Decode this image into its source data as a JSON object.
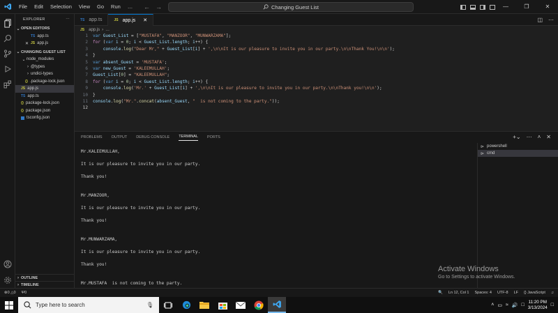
{
  "menu": [
    "File",
    "Edit",
    "Selection",
    "View",
    "Go",
    "Run",
    "…"
  ],
  "command_center": "Changing Guest List",
  "sidebar": {
    "header": "EXPLORER",
    "open_editors_label": "OPEN EDITORS",
    "open_editors": [
      "app.ts",
      "app.js"
    ],
    "project_label": "CHANGING GUEST LIST",
    "tree": [
      {
        "name": "node_modules",
        "kind": "folder",
        "open": true
      },
      {
        "name": "@types",
        "kind": "folder",
        "open": false
      },
      {
        "name": "undici-types",
        "kind": "folder",
        "open": false
      },
      {
        "name": ".package-lock.json",
        "kind": "json"
      },
      {
        "name": "app.js",
        "kind": "js"
      },
      {
        "name": "app.ts",
        "kind": "ts"
      },
      {
        "name": "package-lock.json",
        "kind": "json"
      },
      {
        "name": "package.json",
        "kind": "json"
      },
      {
        "name": "tsconfig.json",
        "kind": "tsconfig"
      }
    ],
    "outline_label": "OUTLINE",
    "timeline_label": "TIMELINE"
  },
  "tabs": [
    {
      "label": "app.ts",
      "active": false
    },
    {
      "label": "app.js",
      "active": true
    }
  ],
  "breadcrumb": [
    "app.js",
    "…"
  ],
  "code_lines": [
    "var Guest_List = [\"MUSTAFA\", \"MANZOOR\", \"MUNWARZAMA\"];",
    "for (var i = 0; i < Guest_List.length; i++) {",
    "    console.log(\"Dear Mr,\" + Guest_List[i] + ',\\n\\nIt is our pleasure to invite you in our party.\\n\\nThank You!\\n\\n');",
    "}",
    "var absent_Guest = 'MUSTAFA';",
    "var new_Guest = 'KALEEMULLAH';",
    "Guest_List[0] = \"KALEEMULLAH\";",
    "for (var i = 0; i < Guest_List.length; i++) {",
    "    console.log('Mr.' + Guest_List[i] + ',\\n\\nIt is our pleasure to invite you in our party.\\n\\nThank you!\\n\\n');",
    "}",
    "console.log(\"Mr.\".concat(absent_Guest, \"  is not coming to the party.\"));",
    ""
  ],
  "panel": {
    "tabs": [
      "PROBLEMS",
      "OUTPUT",
      "DEBUG CONSOLE",
      "TERMINAL",
      "PORTS"
    ],
    "active_tab": "TERMINAL",
    "terminal_lines": [
      "Mr.KALEEMULLAH,",
      "",
      "It is our pleasure to invite you in our party.",
      "",
      "Thank you!",
      "",
      "",
      "Mr.MANZOOR,",
      "",
      "It is our pleasure to invite you in our party.",
      "",
      "Thank you!",
      "",
      "",
      "Mr.MUNWARZAMA,",
      "",
      "It is our pleasure to invite you in our party.",
      "",
      "Thank you!",
      "",
      "",
      "Mr.MUSTAFA  is not coming to the party."
    ],
    "terminals": [
      "powershell",
      "cmd"
    ]
  },
  "watermark": {
    "title": "Activate Windows",
    "subtitle": "Go to Settings to activate Windows."
  },
  "status": {
    "errors": "0",
    "warnings": "0",
    "ports": "0",
    "position": "Ln 12, Col 1",
    "spaces": "Spaces: 4",
    "encoding": "UTF-8",
    "eol": "LF",
    "language": "JavaScript"
  },
  "taskbar": {
    "search_placeholder": "Type here to search",
    "time": "11:20 PM",
    "date": "3/13/2024"
  },
  "colors": {
    "accent": "#0078d4",
    "keyword": "#569cd6",
    "string": "#ce9178",
    "variable": "#9cdcfe",
    "function": "#dcdcaa",
    "control": "#c586c0",
    "number": "#b5cea8"
  }
}
